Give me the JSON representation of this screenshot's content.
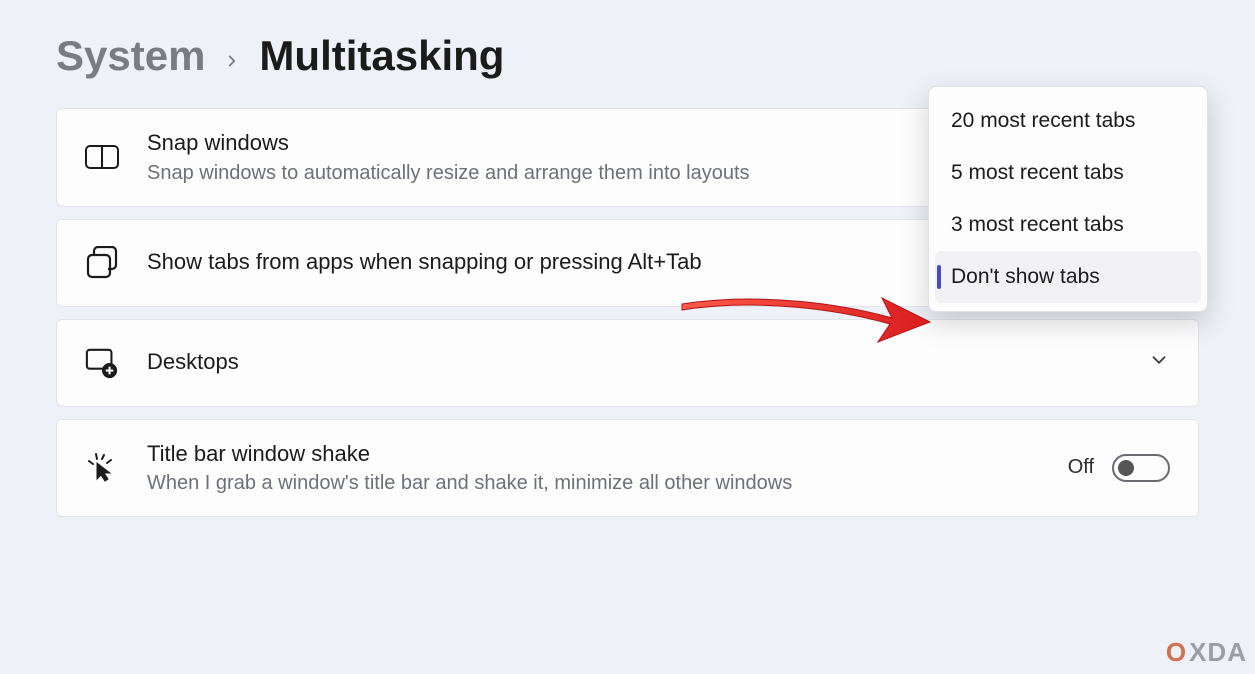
{
  "breadcrumb": {
    "parent": "System",
    "current": "Multitasking"
  },
  "cards": {
    "snap": {
      "title": "Snap windows",
      "sub": "Snap windows to automatically resize and arrange them into layouts"
    },
    "tabs": {
      "title": "Show tabs from apps when snapping or pressing Alt+Tab"
    },
    "desktops": {
      "title": "Desktops"
    },
    "shake": {
      "title": "Title bar window shake",
      "sub": "When I grab a window's title bar and shake it, minimize all other windows",
      "toggle_label": "Off"
    }
  },
  "dropdown": {
    "options": [
      "20 most recent tabs",
      "5 most recent tabs",
      "3 most recent tabs",
      "Don't show tabs"
    ],
    "selected_index": 3
  },
  "watermark": {
    "accent": "O",
    "text": "XDA"
  }
}
